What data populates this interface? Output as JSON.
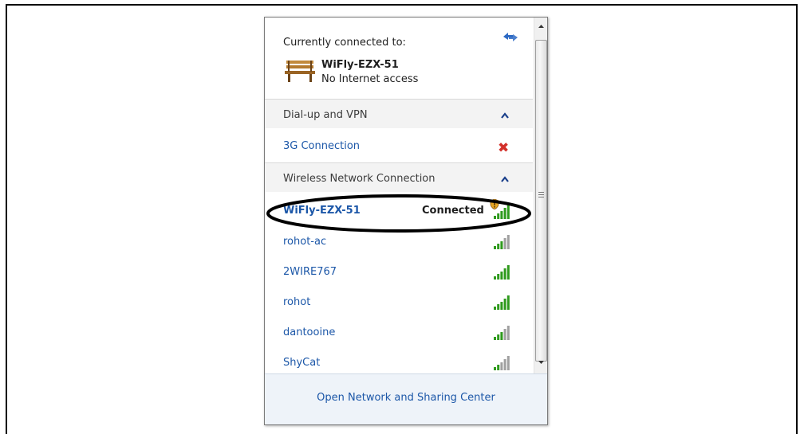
{
  "connected": {
    "heading": "Currently connected to:",
    "network": "WiFly-EZX-51",
    "status": "No Internet access"
  },
  "dialup": {
    "header": "Dial-up and VPN",
    "items": [
      {
        "label": "3G Connection",
        "state_icon": "disconnected-x-icon"
      }
    ]
  },
  "wireless": {
    "header": "Wireless Network Connection",
    "networks": [
      {
        "name": "WiFly-EZX-51",
        "status": "Connected",
        "signal_bars": 5
      },
      {
        "name": "rohot-ac",
        "signal_bars": 3
      },
      {
        "name": "2WIRE767",
        "signal_bars": 5
      },
      {
        "name": "rohot",
        "signal_bars": 5
      },
      {
        "name": "dantooine",
        "signal_bars": 3
      },
      {
        "name": "ShyCat",
        "signal_bars": 2
      }
    ]
  },
  "footer": {
    "link": "Open Network and Sharing Center"
  },
  "colors": {
    "link_blue": "#1c57a8",
    "signal_green": "#2f9a1d",
    "signal_gray": "#a0a0a0",
    "error_red": "#d3302a"
  }
}
